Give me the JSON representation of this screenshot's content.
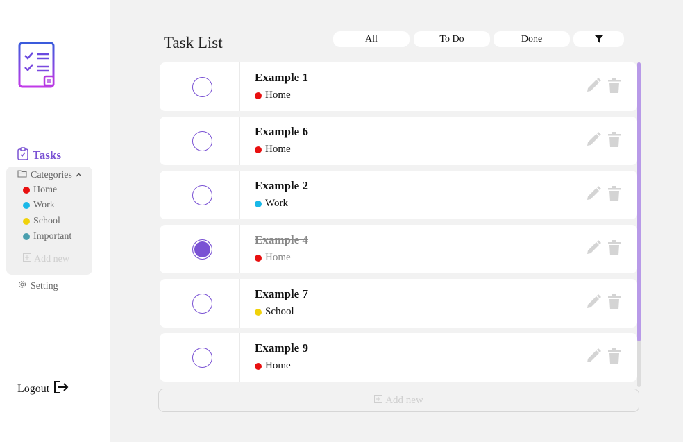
{
  "sidebar": {
    "tasks_label": "Tasks",
    "categories_label": "Categories",
    "categories": [
      {
        "label": "Home",
        "color": "#e81010"
      },
      {
        "label": "Work",
        "color": "#1ab8e8"
      },
      {
        "label": "School",
        "color": "#f0d20a"
      },
      {
        "label": "Important",
        "color": "#4a9fae"
      }
    ],
    "add_new_label": "Add new",
    "setting_label": "Setting",
    "logout_label": "Logout"
  },
  "main": {
    "title": "Task List",
    "filters": [
      "All",
      "To Do",
      "Done"
    ],
    "tasks": [
      {
        "title": "Example 1",
        "category": "Home",
        "color": "#e81010",
        "done": false
      },
      {
        "title": "Example 6",
        "category": "Home",
        "color": "#e81010",
        "done": false
      },
      {
        "title": "Example 2",
        "category": "Work",
        "color": "#1ab8e8",
        "done": false
      },
      {
        "title": "Example 4",
        "category": "Home",
        "color": "#e81010",
        "done": true
      },
      {
        "title": "Example 7",
        "category": "School",
        "color": "#f0d20a",
        "done": false
      },
      {
        "title": "Example 9",
        "category": "Home",
        "color": "#e81010",
        "done": false
      }
    ],
    "add_new_label": "Add new"
  },
  "colors": {
    "accent": "#7a52d4",
    "scroll_thumb": "#b89ae8"
  }
}
